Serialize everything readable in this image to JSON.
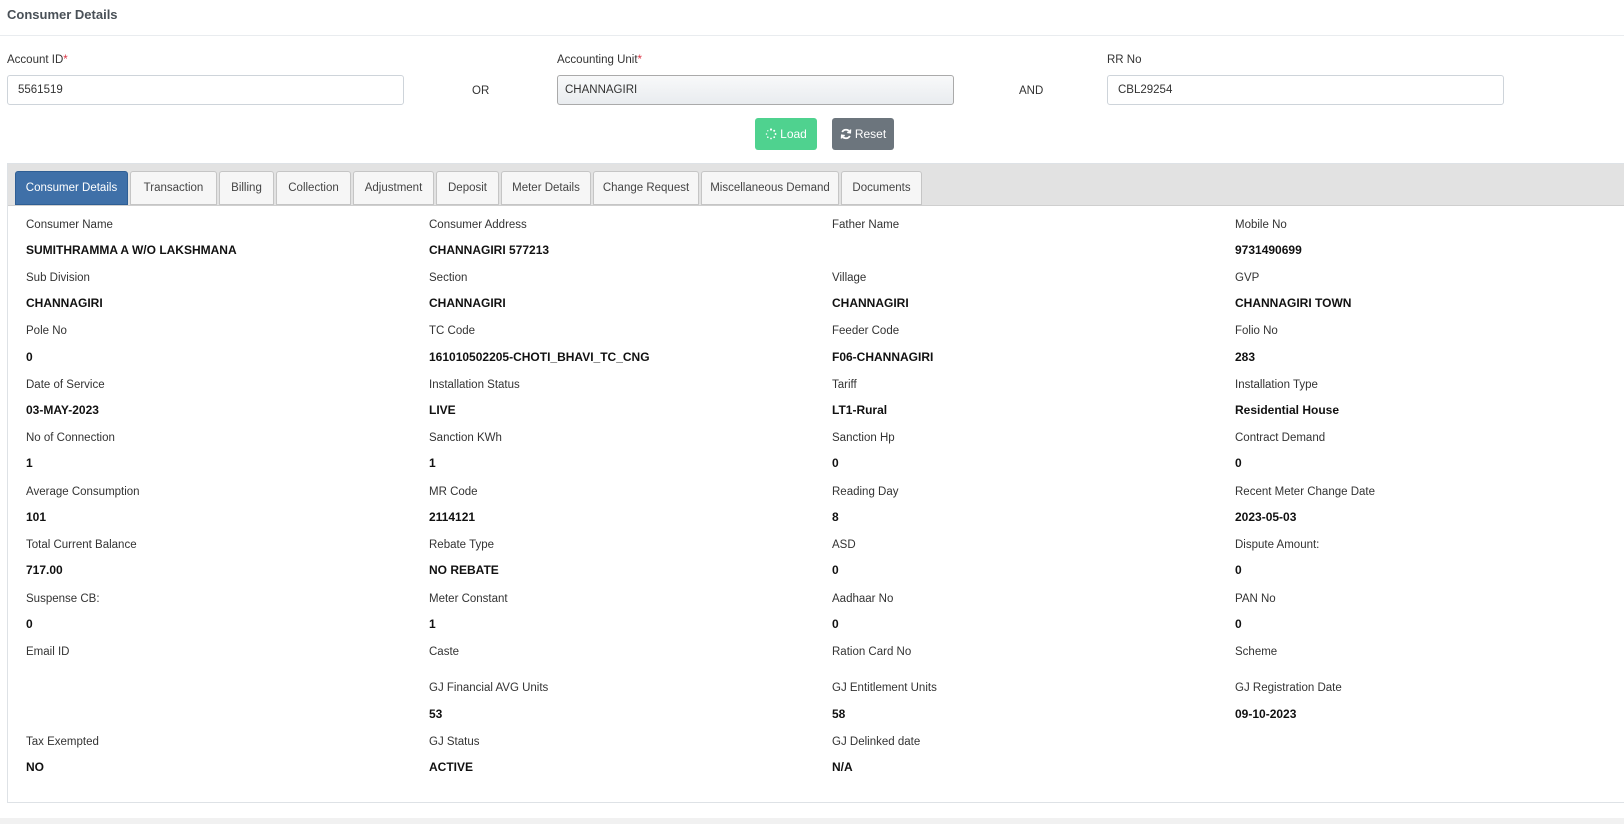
{
  "page": {
    "title": "Consumer Details"
  },
  "form": {
    "account_id": {
      "label": "Account ID",
      "value": "5561519"
    },
    "or_label": "OR",
    "accounting_unit": {
      "label": "Accounting Unit",
      "value": "CHANNAGIRI"
    },
    "and_label": "AND",
    "rr_no": {
      "label": "RR No",
      "value": "CBL29254"
    },
    "required_mark": "*"
  },
  "buttons": {
    "load": "Load",
    "reset": "Reset"
  },
  "tabs": [
    {
      "label": "Consumer Details",
      "active": true
    },
    {
      "label": "Transaction"
    },
    {
      "label": "Billing"
    },
    {
      "label": "Collection"
    },
    {
      "label": "Adjustment"
    },
    {
      "label": "Deposit"
    },
    {
      "label": "Meter Details"
    },
    {
      "label": "Change Request"
    },
    {
      "label": "Miscellaneous Demand"
    },
    {
      "label": "Documents"
    }
  ],
  "details": {
    "consumer_name": {
      "label": "Consumer Name",
      "value": "SUMITHRAMMA A W/O LAKSHMANA"
    },
    "consumer_address": {
      "label": "Consumer Address",
      "value": "CHANNAGIRI 577213"
    },
    "father_name": {
      "label": "Father Name",
      "value": ""
    },
    "mobile_no": {
      "label": "Mobile No",
      "value": "9731490699"
    },
    "sub_division": {
      "label": "Sub Division",
      "value": "CHANNAGIRI"
    },
    "section": {
      "label": "Section",
      "value": "CHANNAGIRI"
    },
    "village": {
      "label": "Village",
      "value": "CHANNAGIRI"
    },
    "gvp": {
      "label": "GVP",
      "value": "CHANNAGIRI TOWN"
    },
    "pole_no": {
      "label": "Pole No",
      "value": "0"
    },
    "tc_code": {
      "label": "TC Code",
      "value": "161010502205-CHOTI_BHAVI_TC_CNG"
    },
    "feeder_code": {
      "label": "Feeder Code",
      "value": "F06-CHANNAGIRI"
    },
    "folio_no": {
      "label": "Folio No",
      "value": "283"
    },
    "date_of_service": {
      "label": "Date of Service",
      "value": "03-MAY-2023"
    },
    "installation_status": {
      "label": "Installation Status",
      "value": "LIVE"
    },
    "tariff": {
      "label": "Tariff",
      "value": "LT1-Rural"
    },
    "installation_type": {
      "label": "Installation Type",
      "value": "Residential House"
    },
    "no_of_connection": {
      "label": "No of Connection",
      "value": "1"
    },
    "sanction_kwh": {
      "label": "Sanction KWh",
      "value": "1"
    },
    "sanction_hp": {
      "label": "Sanction Hp",
      "value": "0"
    },
    "contract_demand": {
      "label": "Contract Demand",
      "value": "0"
    },
    "average_consumption": {
      "label": "Average Consumption",
      "value": "101"
    },
    "mr_code": {
      "label": "MR Code",
      "value": "2114121"
    },
    "reading_day": {
      "label": "Reading Day",
      "value": "8"
    },
    "recent_meter_change_date": {
      "label": "Recent Meter Change Date",
      "value": "2023-05-03"
    },
    "total_current_balance": {
      "label": "Total Current Balance",
      "value": "717.00"
    },
    "rebate_type": {
      "label": "Rebate Type",
      "value": "NO REBATE"
    },
    "asd": {
      "label": "ASD",
      "value": "0"
    },
    "dispute_amount": {
      "label": "Dispute Amount:",
      "value": "0"
    },
    "suspense_cb": {
      "label": "Suspense CB:",
      "value": "0"
    },
    "meter_constant": {
      "label": "Meter Constant",
      "value": "1"
    },
    "aadhaar_no": {
      "label": "Aadhaar No",
      "value": "0"
    },
    "pan_no": {
      "label": "PAN No",
      "value": "0"
    },
    "email_id": {
      "label": "Email ID",
      "value": ""
    },
    "caste": {
      "label": "Caste",
      "value": ""
    },
    "ration_card_no": {
      "label": "Ration Card No",
      "value": ""
    },
    "scheme": {
      "label": "Scheme",
      "value": ""
    },
    "gj_financial_avg_units": {
      "label": "GJ Financial AVG Units",
      "value": "53"
    },
    "gj_entitlement_units": {
      "label": "GJ Entitlement Units",
      "value": "58"
    },
    "gj_registration_date": {
      "label": "GJ Registration Date",
      "value": "09-10-2023"
    },
    "tax_exempted": {
      "label": "Tax Exempted",
      "value": "NO"
    },
    "gj_status": {
      "label": "GJ Status",
      "value": "ACTIVE"
    },
    "gj_delinked_date": {
      "label": "GJ Delinked date",
      "value": "N/A"
    }
  },
  "colors": {
    "tab_active": "#3f70a8",
    "load_button": "#4fd28f",
    "reset_button": "#6c757d",
    "required": "#dc3545"
  },
  "icons": {
    "load": "spinner-icon",
    "reset": "refresh-icon"
  }
}
